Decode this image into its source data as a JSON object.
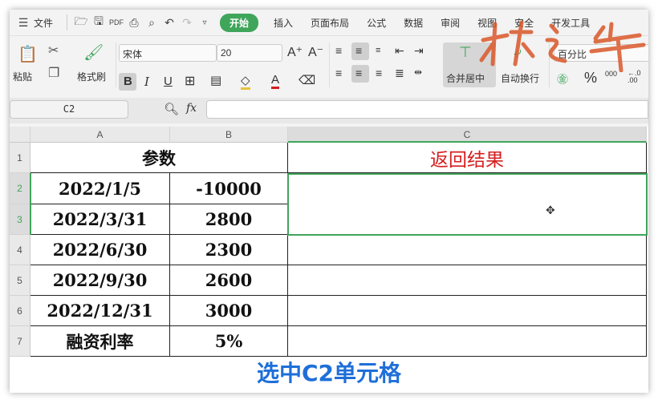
{
  "menu": {
    "file": "文件",
    "tabs": [
      "开始",
      "插入",
      "页面布局",
      "公式",
      "数据",
      "审阅",
      "视图",
      "安全",
      "开发工具"
    ],
    "active": "开始"
  },
  "ribbon": {
    "paste": "粘贴",
    "format_painter": "格式刷",
    "font": "宋体",
    "size": "20",
    "merge": "合并居中",
    "wrap": "自动换行",
    "number_format": "百分比",
    "percent": "%",
    "thousand": "000",
    "decimal": "←.0 .00"
  },
  "formula_bar": {
    "name_box": "C2",
    "fx": "fx",
    "value": ""
  },
  "columns": [
    "A",
    "B",
    "C"
  ],
  "rows": [
    "1",
    "2",
    "3",
    "4",
    "5",
    "6",
    "7"
  ],
  "table": {
    "header": "参数",
    "result_header": "返回结果",
    "dates": [
      "2022/1/5",
      "2022/3/31",
      "2022/6/30",
      "2022/9/30",
      "2022/12/31"
    ],
    "values": [
      "-10000",
      "2800",
      "2300",
      "2600",
      "3000"
    ],
    "rate_label": "融资利率",
    "rate": "5%"
  },
  "caption": "选中C2单元格",
  "watermark": "林之拳",
  "colors": {
    "accent": "#3fa55b",
    "selection": "#3fa55b",
    "result_header": "#d42020",
    "caption": "#1e6fd9"
  }
}
